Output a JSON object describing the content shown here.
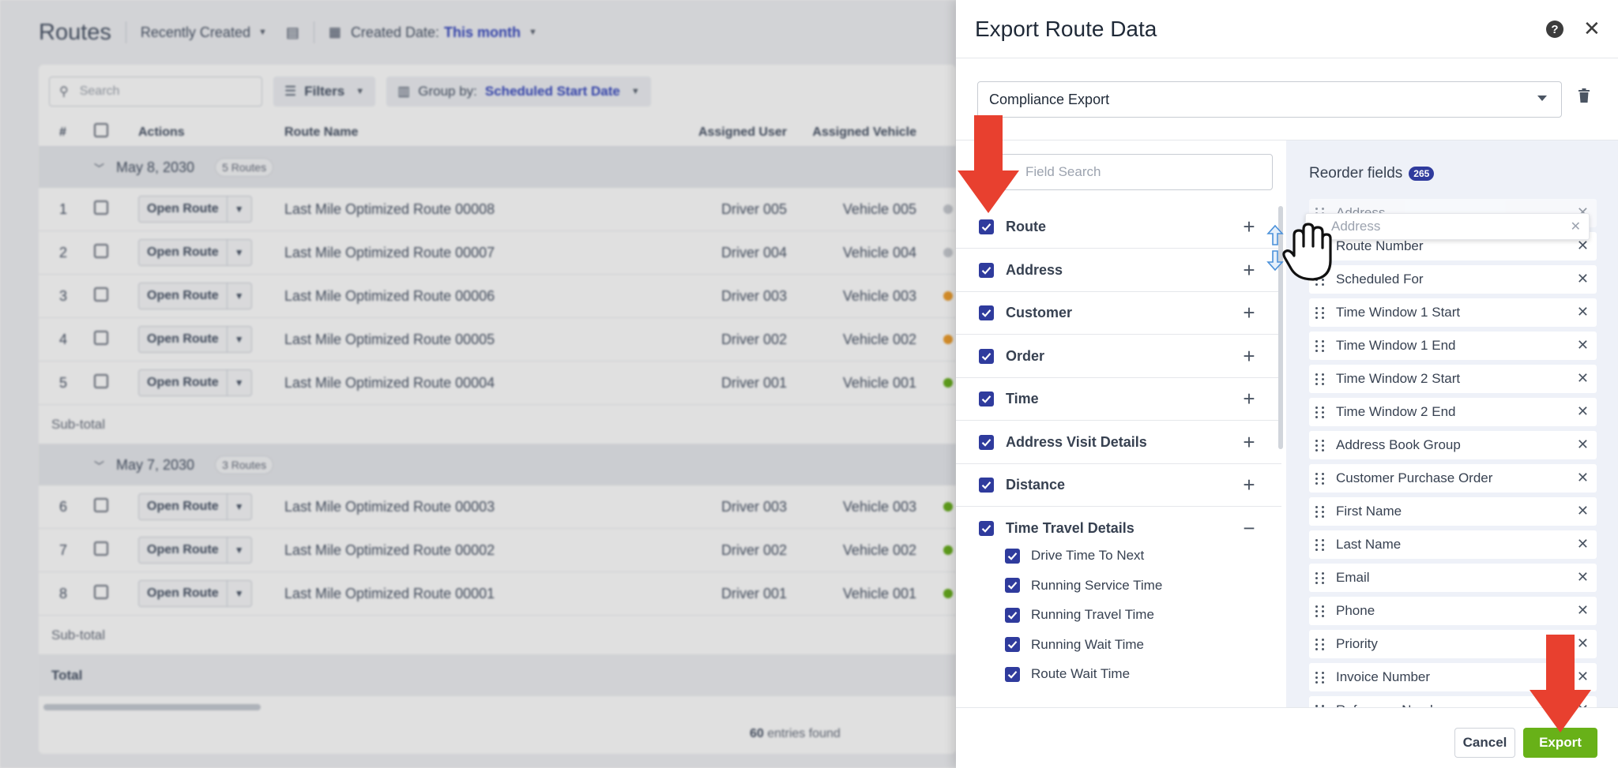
{
  "background": {
    "title": "Routes",
    "sort_label": "Recently Created",
    "date_label": "Created Date:",
    "date_value": "This month",
    "search_placeholder": "Search",
    "filters_label": "Filters",
    "group_by_label": "Group by:",
    "group_by_value": "Scheduled Start Date",
    "columns": [
      "#",
      "Actions",
      "Route Name",
      "Assigned User",
      "Assigned Vehicle"
    ],
    "groups": [
      {
        "date": "May 8, 2030",
        "count": "5 Routes",
        "rows": [
          {
            "num": "1",
            "action": "Open Route",
            "name": "Last Mile Optimized Route 00008",
            "user": "Driver 005",
            "vehicle": "Vehicle 005",
            "status_color": "#c9ccd2"
          },
          {
            "num": "2",
            "action": "Open Route",
            "name": "Last Mile Optimized Route 00007",
            "user": "Driver 004",
            "vehicle": "Vehicle 004",
            "status_color": "#c9ccd2"
          },
          {
            "num": "3",
            "action": "Open Route",
            "name": "Last Mile Optimized Route 00006",
            "user": "Driver 003",
            "vehicle": "Vehicle 003",
            "status_color": "#f0a030"
          },
          {
            "num": "4",
            "action": "Open Route",
            "name": "Last Mile Optimized Route 00005",
            "user": "Driver 002",
            "vehicle": "Vehicle 002",
            "status_color": "#f0a030"
          },
          {
            "num": "5",
            "action": "Open Route",
            "name": "Last Mile Optimized Route 00004",
            "user": "Driver 001",
            "vehicle": "Vehicle 001",
            "status_color": "#6ab020"
          }
        ],
        "subtotal": "Sub-total"
      },
      {
        "date": "May 7, 2030",
        "count": "3 Routes",
        "rows": [
          {
            "num": "6",
            "action": "Open Route",
            "name": "Last Mile Optimized Route 00003",
            "user": "Driver 003",
            "vehicle": "Vehicle 003",
            "status_color": "#6ab020"
          },
          {
            "num": "7",
            "action": "Open Route",
            "name": "Last Mile Optimized Route 00002",
            "user": "Driver 002",
            "vehicle": "Vehicle 002",
            "status_color": "#6ab020"
          },
          {
            "num": "8",
            "action": "Open Route",
            "name": "Last Mile Optimized Route 00001",
            "user": "Driver 001",
            "vehicle": "Vehicle 001",
            "status_color": "#6ab020"
          }
        ],
        "subtotal": "Sub-total"
      }
    ],
    "total_label": "Total",
    "entries_count": "60",
    "entries_label": "entries found"
  },
  "panel": {
    "title": "Export Route Data",
    "template_value": "Compliance Export",
    "field_search_placeholder": "Field Search",
    "categories": [
      {
        "label": "Route",
        "checked": true,
        "toggle": "+"
      },
      {
        "label": "Address",
        "checked": true,
        "toggle": "+"
      },
      {
        "label": "Customer",
        "checked": true,
        "toggle": "+"
      },
      {
        "label": "Order",
        "checked": true,
        "toggle": "+"
      },
      {
        "label": "Time",
        "checked": true,
        "toggle": "+"
      },
      {
        "label": "Address Visit Details",
        "checked": true,
        "toggle": "+"
      },
      {
        "label": "Distance",
        "checked": true,
        "toggle": "+"
      },
      {
        "label": "Time Travel Details",
        "checked": true,
        "toggle": "−"
      }
    ],
    "time_travel_fields": [
      "Drive Time To Next",
      "Running Service Time",
      "Running Travel Time",
      "Running Wait Time",
      "Route Wait Time"
    ],
    "reorder_title": "Reorder fields",
    "reorder_count": "265",
    "reorder_fields": [
      "Address",
      "Route Number",
      "Scheduled For",
      "Time Window 1 Start",
      "Time Window 1 End",
      "Time Window 2 Start",
      "Time Window 2 End",
      "Address Book Group",
      "Customer Purchase Order",
      "First Name",
      "Last Name",
      "Email",
      "Phone",
      "Priority",
      "Invoice Number",
      "Reference Number"
    ],
    "dragging_field": "Address",
    "cancel_label": "Cancel",
    "export_label": "Export"
  },
  "colors": {
    "accent": "#2f3b9d",
    "export_green": "#68b118",
    "annotation_red": "#e8402f"
  }
}
